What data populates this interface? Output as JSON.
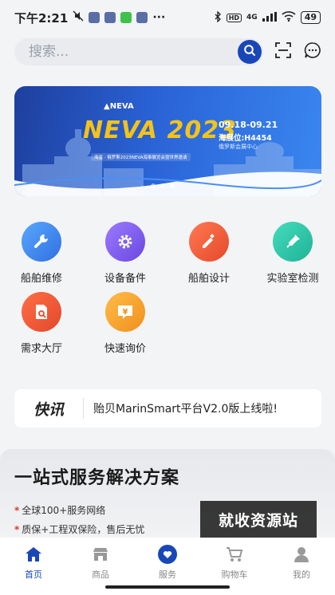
{
  "status_bar": {
    "time": "下午2:21",
    "network": "4G",
    "battery": "49"
  },
  "search": {
    "placeholder": "搜索..."
  },
  "banner": {
    "brand": "NEVA",
    "title_prefix": "NEVA",
    "title_year": "2023",
    "subline": "海玺 · 俄罗斯2023NEVA海事展览会暨世界邀请",
    "dates": "09.18-09.21",
    "booth": "海展位:H4454",
    "venue": "俄罗斯会展中心",
    "slides": 3,
    "active_slide": 3
  },
  "services": [
    {
      "label": "船舶维修",
      "color": "#3d8ef0",
      "icon": "wrench-icon"
    },
    {
      "label": "设备备件",
      "color": "#7b5bea",
      "icon": "gear-icon"
    },
    {
      "label": "船舶设计",
      "color": "#f0603a",
      "icon": "pencil-ruler-icon"
    },
    {
      "label": "实验室检测",
      "color": "#2ec6a8",
      "icon": "dropper-icon"
    },
    {
      "label": "需求大厅",
      "color": "#f05a35",
      "icon": "document-search-icon"
    },
    {
      "label": "快速询价",
      "color": "#f5a332",
      "icon": "price-tag-icon"
    }
  ],
  "news": {
    "tag": "快讯",
    "text": "贻贝MarinSmart平台V2.0版上线啦!"
  },
  "solution": {
    "title": "一站式服务解决方案",
    "points": [
      "全球100+服务网络",
      "质保+工程双保险，售后无忧"
    ]
  },
  "watermark": "就收资源站",
  "tabs": [
    {
      "label": "首页",
      "icon": "home-icon",
      "active": true
    },
    {
      "label": "商品",
      "icon": "store-icon",
      "active": false
    },
    {
      "label": "服务",
      "icon": "service-icon",
      "active": false
    },
    {
      "label": "购物车",
      "icon": "cart-icon",
      "active": false
    },
    {
      "label": "我的",
      "icon": "profile-icon",
      "active": false
    }
  ],
  "colors": {
    "brand": "#1a47b8",
    "banner_gold": "#f4c318"
  }
}
